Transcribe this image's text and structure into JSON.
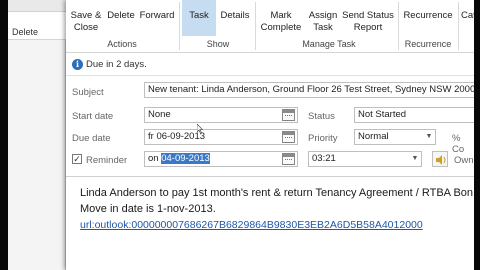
{
  "back_window": {
    "delete_label": "Delete"
  },
  "ribbon": {
    "buttons": {
      "save_close": "Save &\nClose",
      "delete": "Delete",
      "forward": "Forward",
      "task": "Task",
      "details": "Details",
      "mark_complete": "Mark\nComplete",
      "assign_task": "Assign\nTask",
      "send_status_report": "Send Status\nReport",
      "recurrence": "Recurrence",
      "categorize_partial": "Cat"
    },
    "groups": {
      "actions": "Actions",
      "show": "Show",
      "manage_task": "Manage Task",
      "recurrence": "Recurrence"
    }
  },
  "infobar": {
    "text": "Due in 2 days."
  },
  "form": {
    "subject_label": "Subject",
    "subject_value": "New tenant: Linda Anderson, Ground Floor 26 Test Street, Sydney NSW 2000",
    "start_date_label": "Start date",
    "start_date_value": "None",
    "due_date_label": "Due date",
    "due_date_value": "fr 06-09-2013",
    "status_label": "Status",
    "status_value": "Not Started",
    "priority_label": "Priority",
    "priority_value": "Normal",
    "percent_complete_partial": "% Co",
    "reminder_label": "Reminder",
    "reminder_checked": "✓",
    "reminder_date_prefix": "on ",
    "reminder_date_selected": "04-09-2013",
    "reminder_time": "03:21",
    "owner_partial": "Own"
  },
  "notes": {
    "line1": "Linda Anderson to pay 1st month's rent  & return Tenancy Agreement / RTBA Bon",
    "line2": "Move in date is 1-nov-2013.",
    "link": "url:outlook:000000007686267B6829864B9830E3EB2A6D5B58A4012000"
  }
}
